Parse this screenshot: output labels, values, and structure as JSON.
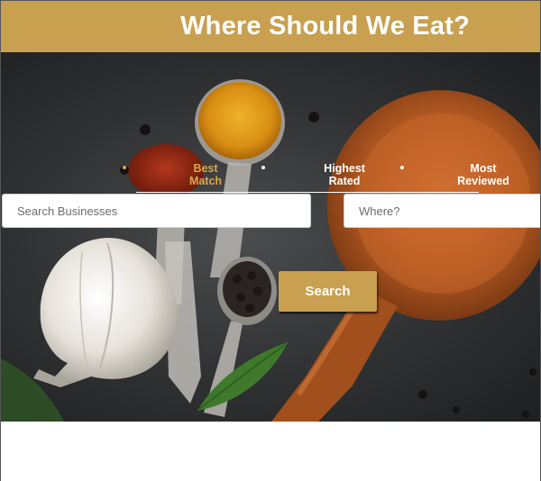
{
  "header": {
    "title": "Where Should We Eat?"
  },
  "sort_options": [
    {
      "label_line1": "Best",
      "label_line2": "Match",
      "active": true
    },
    {
      "label_line1": "Highest",
      "label_line2": "Rated",
      "active": false
    },
    {
      "label_line1": "Most",
      "label_line2": "Reviewed",
      "active": false
    }
  ],
  "search": {
    "term_placeholder": "Search Businesses",
    "location_placeholder": "Where?",
    "button_label": "Search"
  },
  "colors": {
    "brand_gold": "#c9a050",
    "active_sort": "#d8a84e",
    "text_light": "#ffffff"
  }
}
